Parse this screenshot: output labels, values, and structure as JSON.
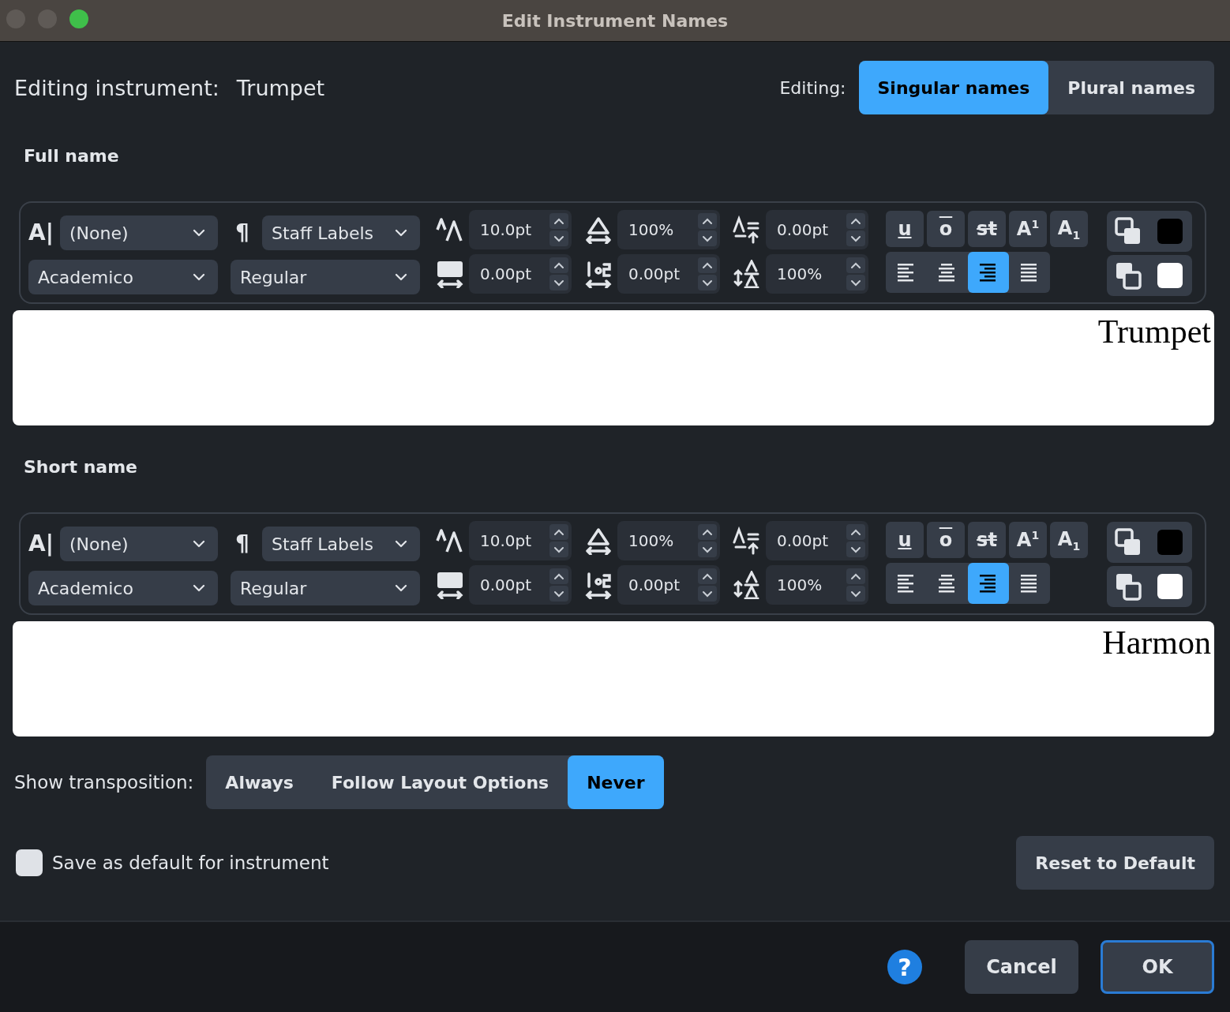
{
  "window": {
    "title": "Edit Instrument Names"
  },
  "instrument": {
    "label": "Editing instrument:",
    "value": "Trumpet"
  },
  "editing": {
    "label": "Editing:",
    "options": [
      {
        "label": "Singular names",
        "selected": true
      },
      {
        "label": "Plural names",
        "selected": false
      }
    ]
  },
  "sections": [
    {
      "heading": "Full name",
      "toolbar": {
        "character_style": {
          "glyph": "A|",
          "value": "(None)"
        },
        "paragraph_style": {
          "glyph": "¶",
          "value": "Staff Labels"
        },
        "font": "Academico",
        "font_style": "Regular",
        "fields": [
          {
            "kind": "size",
            "value": "10.0pt"
          },
          {
            "kind": "width",
            "value": "100%"
          },
          {
            "kind": "baseline",
            "value": "0.00pt"
          },
          {
            "kind": "tracking",
            "value": "0.00pt"
          },
          {
            "kind": "spacing",
            "value": "0.00pt"
          },
          {
            "kind": "line",
            "value": "100%"
          }
        ],
        "formats": [
          {
            "kind": "underline",
            "label": "u",
            "selected": false
          },
          {
            "kind": "overline",
            "label": "o",
            "selected": false
          },
          {
            "kind": "strike",
            "label": "st",
            "selected": false
          },
          {
            "kind": "superscript",
            "label": "A$^{1}$",
            "selected": false
          },
          {
            "kind": "subscript",
            "label": "A$_{1}$",
            "selected": false
          }
        ],
        "alignment": [
          {
            "kind": "left",
            "selected": false
          },
          {
            "kind": "center",
            "selected": false
          },
          {
            "kind": "right",
            "selected": true
          },
          {
            "kind": "justify",
            "selected": false
          }
        ],
        "colors": [
          {
            "kind": "foreground",
            "color": "#000000"
          },
          {
            "kind": "background",
            "color": "#ffffff"
          }
        ]
      },
      "preview": "Trumpet"
    },
    {
      "heading": "Short name",
      "toolbar": {
        "character_style": {
          "glyph": "A|",
          "value": "(None)"
        },
        "paragraph_style": {
          "glyph": "¶",
          "value": "Staff Labels"
        },
        "font": "Academico",
        "font_style": "Regular",
        "fields": [
          {
            "kind": "size",
            "value": "10.0pt"
          },
          {
            "kind": "width",
            "value": "100%"
          },
          {
            "kind": "baseline",
            "value": "0.00pt"
          },
          {
            "kind": "tracking",
            "value": "0.00pt"
          },
          {
            "kind": "spacing",
            "value": "0.00pt"
          },
          {
            "kind": "line",
            "value": "100%"
          }
        ],
        "formats": [
          {
            "kind": "underline",
            "label": "u",
            "selected": false
          },
          {
            "kind": "overline",
            "label": "o",
            "selected": false
          },
          {
            "kind": "strike",
            "label": "st",
            "selected": false
          },
          {
            "kind": "superscript",
            "label": "A$^{1}$",
            "selected": false
          },
          {
            "kind": "subscript",
            "label": "A$_{1}$",
            "selected": false
          }
        ],
        "alignment": [
          {
            "kind": "left",
            "selected": false
          },
          {
            "kind": "center",
            "selected": false
          },
          {
            "kind": "right",
            "selected": true
          },
          {
            "kind": "justify",
            "selected": false
          }
        ],
        "colors": [
          {
            "kind": "foreground",
            "color": "#000000"
          },
          {
            "kind": "background",
            "color": "#ffffff"
          }
        ]
      },
      "preview": "Harmon"
    }
  ],
  "transposition": {
    "label": "Show transposition:",
    "options": [
      {
        "label": "Always",
        "selected": false
      },
      {
        "label": "Follow Layout Options",
        "selected": false
      },
      {
        "label": "Never",
        "selected": true
      }
    ]
  },
  "save_default": {
    "label": "Save as default for instrument",
    "checked": false
  },
  "reset_button": "Reset to Default",
  "footer": {
    "help": "?",
    "buttons": [
      {
        "kind": "secondary",
        "label": "Cancel"
      },
      {
        "kind": "primary",
        "label": "OK"
      }
    ]
  }
}
